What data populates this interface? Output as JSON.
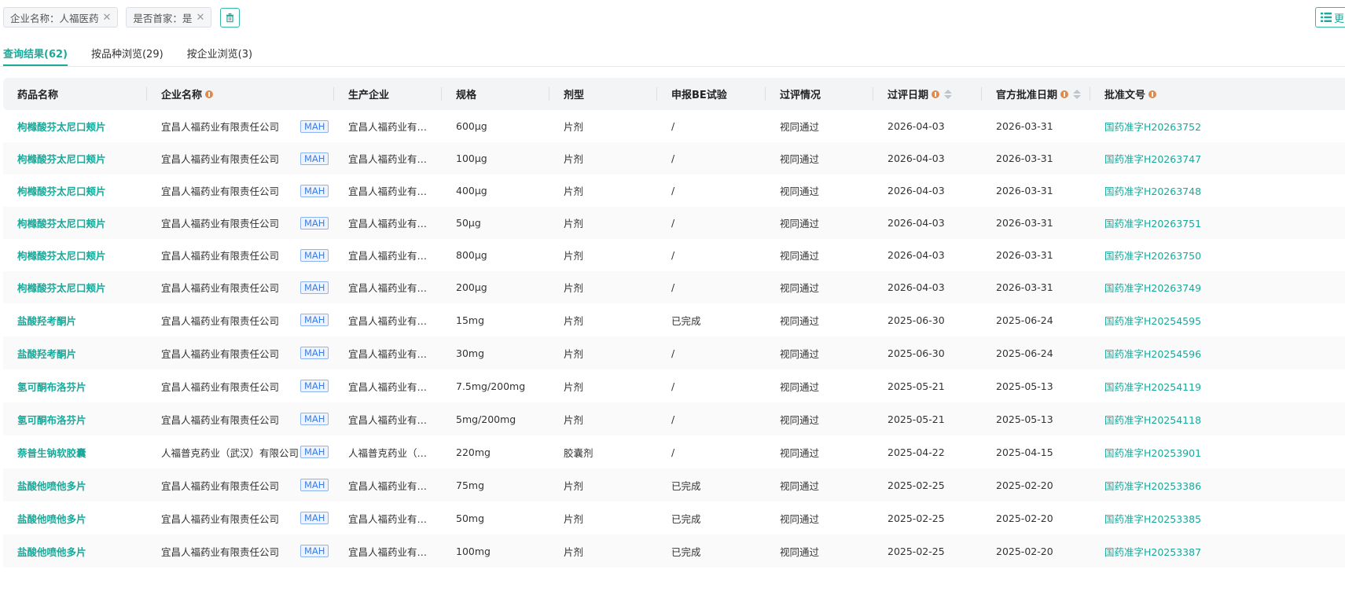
{
  "filters": [
    {
      "label": "企业名称：人福医药"
    },
    {
      "label": "是否首家：是"
    }
  ],
  "more_label": "更多",
  "tabs": [
    {
      "label": "查询结果(62)",
      "active": true
    },
    {
      "label": "按品种浏览(29)",
      "active": false
    },
    {
      "label": "按企业浏览(3)",
      "active": false
    }
  ],
  "columns": [
    "药品名称",
    "企业名称",
    "生产企业",
    "规格",
    "剂型",
    "申报BE试验",
    "过评情况",
    "过评日期",
    "官方批准日期",
    "批准文号"
  ],
  "mah_label": "MAH",
  "rows": [
    {
      "drug": "枸橼酸芬太尼口颊片",
      "company": "宜昌人福药业有限责任公司",
      "manufacturer": "宜昌人福药业有限…",
      "spec": "600μg",
      "form": "片剂",
      "be": "/",
      "status": "视同通过",
      "review_date": "2026-04-03",
      "approval_date": "2026-03-31",
      "approval_no": "国药准字H20263752"
    },
    {
      "drug": "枸橼酸芬太尼口颊片",
      "company": "宜昌人福药业有限责任公司",
      "manufacturer": "宜昌人福药业有限…",
      "spec": "100μg",
      "form": "片剂",
      "be": "/",
      "status": "视同通过",
      "review_date": "2026-04-03",
      "approval_date": "2026-03-31",
      "approval_no": "国药准字H20263747"
    },
    {
      "drug": "枸橼酸芬太尼口颊片",
      "company": "宜昌人福药业有限责任公司",
      "manufacturer": "宜昌人福药业有限…",
      "spec": "400μg",
      "form": "片剂",
      "be": "/",
      "status": "视同通过",
      "review_date": "2026-04-03",
      "approval_date": "2026-03-31",
      "approval_no": "国药准字H20263748"
    },
    {
      "drug": "枸橼酸芬太尼口颊片",
      "company": "宜昌人福药业有限责任公司",
      "manufacturer": "宜昌人福药业有限…",
      "spec": "50μg",
      "form": "片剂",
      "be": "/",
      "status": "视同通过",
      "review_date": "2026-04-03",
      "approval_date": "2026-03-31",
      "approval_no": "国药准字H20263751"
    },
    {
      "drug": "枸橼酸芬太尼口颊片",
      "company": "宜昌人福药业有限责任公司",
      "manufacturer": "宜昌人福药业有限…",
      "spec": "800μg",
      "form": "片剂",
      "be": "/",
      "status": "视同通过",
      "review_date": "2026-04-03",
      "approval_date": "2026-03-31",
      "approval_no": "国药准字H20263750"
    },
    {
      "drug": "枸橼酸芬太尼口颊片",
      "company": "宜昌人福药业有限责任公司",
      "manufacturer": "宜昌人福药业有限…",
      "spec": "200μg",
      "form": "片剂",
      "be": "/",
      "status": "视同通过",
      "review_date": "2026-04-03",
      "approval_date": "2026-03-31",
      "approval_no": "国药准字H20263749"
    },
    {
      "drug": "盐酸羟考酮片",
      "company": "宜昌人福药业有限责任公司",
      "manufacturer": "宜昌人福药业有限…",
      "spec": "15mg",
      "form": "片剂",
      "be": "已完成",
      "status": "视同通过",
      "review_date": "2025-06-30",
      "approval_date": "2025-06-24",
      "approval_no": "国药准字H20254595"
    },
    {
      "drug": "盐酸羟考酮片",
      "company": "宜昌人福药业有限责任公司",
      "manufacturer": "宜昌人福药业有限…",
      "spec": "30mg",
      "form": "片剂",
      "be": "/",
      "status": "视同通过",
      "review_date": "2025-06-30",
      "approval_date": "2025-06-24",
      "approval_no": "国药准字H20254596"
    },
    {
      "drug": "氢可酮布洛芬片",
      "company": "宜昌人福药业有限责任公司",
      "manufacturer": "宜昌人福药业有限…",
      "spec": "7.5mg/200mg",
      "form": "片剂",
      "be": "/",
      "status": "视同通过",
      "review_date": "2025-05-21",
      "approval_date": "2025-05-13",
      "approval_no": "国药准字H20254119"
    },
    {
      "drug": "氢可酮布洛芬片",
      "company": "宜昌人福药业有限责任公司",
      "manufacturer": "宜昌人福药业有限…",
      "spec": "5mg/200mg",
      "form": "片剂",
      "be": "/",
      "status": "视同通过",
      "review_date": "2025-05-21",
      "approval_date": "2025-05-13",
      "approval_no": "国药准字H20254118"
    },
    {
      "drug": "萘普生钠软胶囊",
      "company": "人福普克药业（武汉）有限公司",
      "manufacturer": "人福普克药业（武…",
      "spec": "220mg",
      "form": "胶囊剂",
      "be": "/",
      "status": "视同通过",
      "review_date": "2025-04-22",
      "approval_date": "2025-04-15",
      "approval_no": "国药准字H20253901"
    },
    {
      "drug": "盐酸他喷他多片",
      "company": "宜昌人福药业有限责任公司",
      "manufacturer": "宜昌人福药业有限…",
      "spec": "75mg",
      "form": "片剂",
      "be": "已完成",
      "status": "视同通过",
      "review_date": "2025-02-25",
      "approval_date": "2025-02-20",
      "approval_no": "国药准字H20253386"
    },
    {
      "drug": "盐酸他喷他多片",
      "company": "宜昌人福药业有限责任公司",
      "manufacturer": "宜昌人福药业有限…",
      "spec": "50mg",
      "form": "片剂",
      "be": "已完成",
      "status": "视同通过",
      "review_date": "2025-02-25",
      "approval_date": "2025-02-20",
      "approval_no": "国药准字H20253385"
    },
    {
      "drug": "盐酸他喷他多片",
      "company": "宜昌人福药业有限责任公司",
      "manufacturer": "宜昌人福药业有限…",
      "spec": "100mg",
      "form": "片剂",
      "be": "已完成",
      "status": "视同通过",
      "review_date": "2025-02-25",
      "approval_date": "2025-02-20",
      "approval_no": "国药准字H20253387"
    }
  ]
}
